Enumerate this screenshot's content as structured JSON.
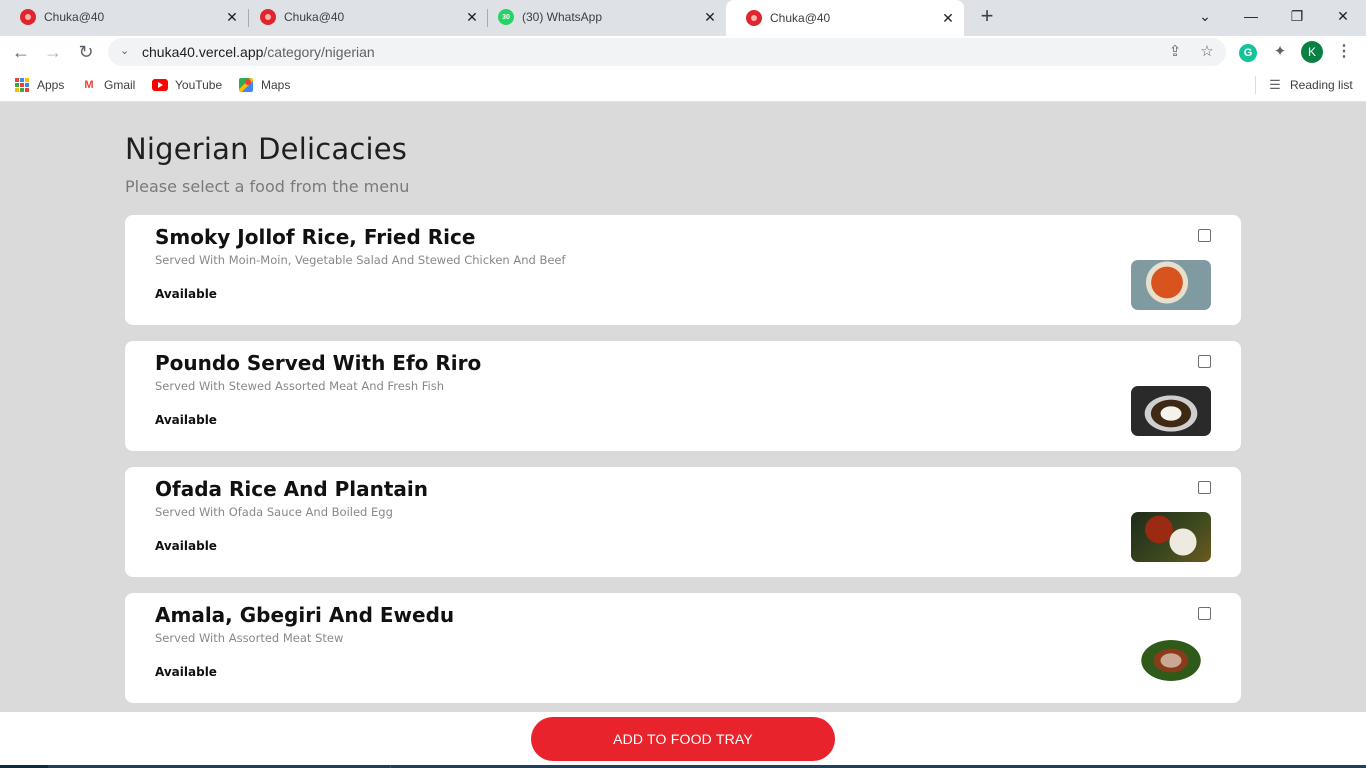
{
  "browser": {
    "tabs": [
      {
        "title": "Chuka@40",
        "icon": "chuka-favicon"
      },
      {
        "title": "Chuka@40",
        "icon": "chuka-favicon"
      },
      {
        "title": "(30) WhatsApp",
        "icon": "whatsapp-favicon",
        "badge": "30"
      },
      {
        "title": "Chuka@40",
        "icon": "chuka-favicon",
        "active": true
      }
    ],
    "url_host": "chuka40.vercel.app",
    "url_path": "/category/nigerian",
    "profile_initial": "K",
    "grammarly_letter": "G",
    "bookmarks": [
      {
        "label": "Apps",
        "icon": "apps-grid-icon"
      },
      {
        "label": "Gmail",
        "icon": "gmail-icon"
      },
      {
        "label": "YouTube",
        "icon": "youtube-icon"
      },
      {
        "label": "Maps",
        "icon": "maps-icon"
      }
    ],
    "reading_list": "Reading list"
  },
  "page": {
    "title": "Nigerian Delicacies",
    "subtitle": "Please select a food from the menu",
    "foods": [
      {
        "name": "Smoky Jollof Rice, Fried Rice",
        "description": "Served With Moin-Moin, Vegetable Salad And Stewed Chicken And Beef",
        "status": "Available",
        "checked": false,
        "image": "jollof-rice-photo"
      },
      {
        "name": "Poundo Served With Efo Riro",
        "description": "Served With Stewed Assorted Meat And Fresh Fish",
        "status": "Available",
        "checked": false,
        "image": "poundo-efo-riro-photo"
      },
      {
        "name": "Ofada Rice And Plantain",
        "description": "Served With Ofada Sauce And Boiled Egg",
        "status": "Available",
        "checked": false,
        "image": "ofada-rice-photo"
      },
      {
        "name": "Amala, Gbegiri And Ewedu",
        "description": "Served With Assorted Meat Stew",
        "status": "Available",
        "checked": false,
        "image": "amala-gbegiri-photo"
      }
    ],
    "add_button": "ADD TO FOOD TRAY"
  },
  "colors": {
    "accent_red": "#e8232b",
    "page_bg": "#dadada",
    "card_bg": "#ffffff"
  }
}
